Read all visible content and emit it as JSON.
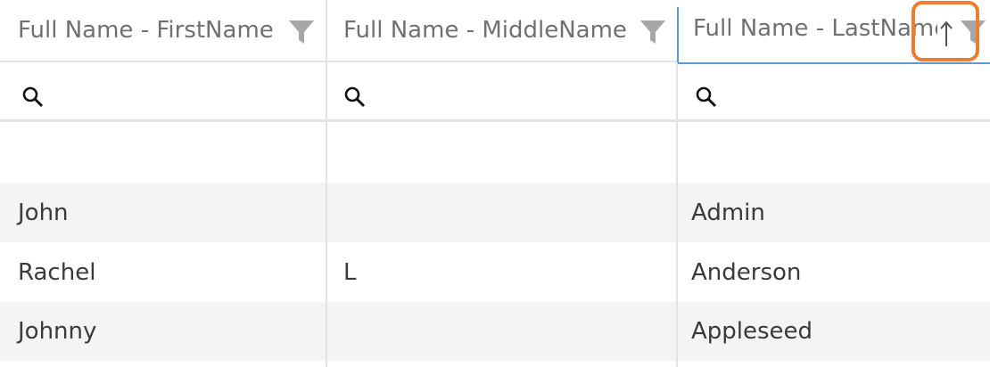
{
  "columns": [
    {
      "header": "Full Name - FirstName"
    },
    {
      "header": "Full Name - MiddleName"
    },
    {
      "header": "Full Name - LastName"
    }
  ],
  "sort": {
    "column": "Full Name - LastName",
    "direction": "ascending"
  },
  "rows": [
    {
      "first": "",
      "middle": "",
      "last": ""
    },
    {
      "first": "John",
      "middle": "",
      "last": "Admin"
    },
    {
      "first": "Rachel",
      "middle": "L",
      "last": "Anderson"
    },
    {
      "first": "Johnny",
      "middle": "",
      "last": "Appleseed"
    }
  ],
  "colors": {
    "active_header_border": "#5b9bd5",
    "highlight": "#ed7d31"
  },
  "icons": {
    "filter": "funnel-icon",
    "search": "magnifier-icon",
    "sort": "up-arrow-icon"
  }
}
